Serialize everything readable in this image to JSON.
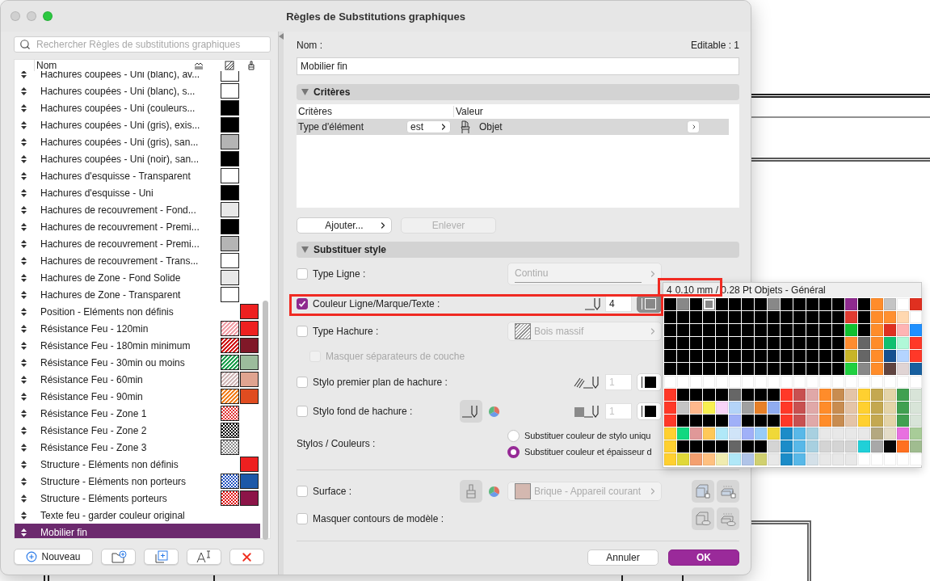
{
  "window": {
    "title": "Règles de Substitutions graphiques"
  },
  "sidebar": {
    "search": {
      "placeholder": "Rechercher Règles de substitutions graphiques"
    },
    "column": "Nom",
    "items": [
      {
        "name": "Hachures coupées - Uni (blanc), av...",
        "selected": false,
        "fill": {
          "kind": "solid",
          "color": "#ffffff"
        }
      },
      {
        "name": "Hachures coupées - Uni (blanc), s...",
        "selected": false,
        "fill": {
          "kind": "solid",
          "color": "#ffffff"
        }
      },
      {
        "name": "Hachures coupées - Uni (couleurs...",
        "selected": false,
        "fill": {
          "kind": "solid",
          "color": "#000000"
        }
      },
      {
        "name": "Hachures coupées - Uni (gris), exis...",
        "selected": false,
        "fill": {
          "kind": "solid",
          "color": "#000000"
        }
      },
      {
        "name": "Hachures coupées - Uni (gris), san...",
        "selected": false,
        "fill": {
          "kind": "solid",
          "color": "#b4b4b4"
        }
      },
      {
        "name": "Hachures coupées - Uni (noir), san...",
        "selected": false,
        "fill": {
          "kind": "solid",
          "color": "#000000"
        }
      },
      {
        "name": "Hachures d'esquisse - Transparent",
        "selected": false,
        "fill": {
          "kind": "solid",
          "color": "#ffffff"
        }
      },
      {
        "name": "Hachures d'esquisse - Uni",
        "selected": false,
        "fill": {
          "kind": "solid",
          "color": "#000000"
        }
      },
      {
        "name": "Hachures de recouvrement - Fond...",
        "selected": false,
        "fill": {
          "kind": "solid",
          "color": "#e8e8e8"
        }
      },
      {
        "name": "Hachures de recouvrement - Premi...",
        "selected": false,
        "fill": {
          "kind": "solid",
          "color": "#000000"
        }
      },
      {
        "name": "Hachures de recouvrement - Premi...",
        "selected": false,
        "fill": {
          "kind": "solid",
          "color": "#b4b4b4"
        }
      },
      {
        "name": "Hachures de recouvrement - Trans...",
        "selected": false,
        "fill": {
          "kind": "solid",
          "color": "#ffffff"
        }
      },
      {
        "name": "Hachures de Zone - Fond Solide",
        "selected": false,
        "fill": {
          "kind": "solid",
          "color": "#e8e8e8"
        }
      },
      {
        "name": "Hachures de Zone - Transparent",
        "selected": false,
        "fill": {
          "kind": "solid",
          "color": "#ffffff"
        }
      },
      {
        "name": "Position - Eléments non définis",
        "selected": false,
        "pen": {
          "color": "#ee2020"
        }
      },
      {
        "name": "Résistance Feu - 120min",
        "selected": false,
        "fill": {
          "kind": "hatch",
          "color": "#f0a0a8"
        },
        "pen": {
          "color": "#ee2020"
        }
      },
      {
        "name": "Résistance Feu - 180min minimum",
        "selected": false,
        "fill": {
          "kind": "hatch",
          "color": "#d01818"
        },
        "pen": {
          "color": "#801828"
        }
      },
      {
        "name": "Résistance Feu - 30min ou moins",
        "selected": false,
        "fill": {
          "kind": "hatch",
          "color": "#20a050"
        },
        "pen": {
          "color": "#9cbc9c"
        }
      },
      {
        "name": "Résistance Feu - 60min",
        "selected": false,
        "fill": {
          "kind": "hatch",
          "color": "#d0b8b8"
        },
        "pen": {
          "color": "#e0a490"
        }
      },
      {
        "name": "Résistance Feu - 90min",
        "selected": false,
        "fill": {
          "kind": "hatch",
          "color": "#f08020"
        },
        "pen": {
          "color": "#e04c20"
        }
      },
      {
        "name": "Résistance Feu - Zone 1",
        "selected": false,
        "fill": {
          "kind": "dots",
          "color": "#e03030"
        }
      },
      {
        "name": "Résistance Feu - Zone 2",
        "selected": false,
        "fill": {
          "kind": "dots",
          "color": "#000000"
        }
      },
      {
        "name": "Résistance Feu - Zone 3",
        "selected": false,
        "fill": {
          "kind": "dots",
          "color": "#888888"
        }
      },
      {
        "name": "Structure - Eléments non définis",
        "selected": false,
        "pen": {
          "color": "#ee2020"
        }
      },
      {
        "name": "Structure - Eléments non porteurs",
        "selected": false,
        "fill": {
          "kind": "dots",
          "color": "#2050c0"
        },
        "pen": {
          "color": "#1c58a8"
        }
      },
      {
        "name": "Structure - Eléments porteurs",
        "selected": false,
        "fill": {
          "kind": "dots",
          "color": "#e01010"
        },
        "pen": {
          "color": "#8c1448"
        }
      },
      {
        "name": "Texte feu - garder couleur original",
        "selected": false
      },
      {
        "name": "Mobilier fin",
        "selected": true
      }
    ],
    "new_button": "Nouveau"
  },
  "rule": {
    "name_label": "Nom :",
    "editable": "Editable : 1",
    "name_value": "Mobilier fin",
    "criteria": {
      "title": "Critères",
      "expanded": true,
      "columns": [
        "Critères",
        "Valeur"
      ],
      "rows": [
        {
          "criterion": "Type d'élément",
          "operator": "est",
          "value": "Objet",
          "selected": true
        }
      ],
      "buttons": [
        {
          "label": "Ajouter...",
          "disabled": false
        },
        {
          "label": "Enlever",
          "disabled": true
        }
      ]
    },
    "style": {
      "title": "Substituer style",
      "expanded": true,
      "options": [
        {
          "kind": "line_type",
          "label": "Type Ligne :",
          "checked": false,
          "value": "Continu"
        },
        {
          "kind": "pen",
          "label": "Couleur Ligne/Marque/Texte :",
          "checked": true,
          "pen": "4"
        },
        {
          "kind": "fill_type",
          "label": "Type Hachure :",
          "checked": false,
          "value": "Bois massif"
        },
        {
          "kind": "sub_check",
          "label": "Masquer séparateurs de couche",
          "checked": false,
          "disabled": true
        },
        {
          "kind": "fill_pen",
          "label": "Stylo premier plan de hachure :",
          "checked": false,
          "pen": "1"
        },
        {
          "kind": "fill_bg_pen",
          "label": "Stylo fond de hachure :",
          "checked": false,
          "pen": "1"
        },
        {
          "kind": "radio_group",
          "label": "Stylos / Couleurs :",
          "choices": [
            {
              "label": "Substituer couleur de stylo uniqu",
              "selected": false
            },
            {
              "label": "Substituer couleur et épaisseur d",
              "selected": true
            }
          ]
        },
        {
          "kind": "surface",
          "label": "Surface :",
          "checked": false,
          "value": "Brique - Appareil courant",
          "color": "#d4b8b0"
        },
        {
          "kind": "model_contours",
          "label": "Masquer contours de modèle :",
          "checked": false
        }
      ]
    },
    "buttons": [
      {
        "label": "Annuler",
        "primary": false
      },
      {
        "label": "OK",
        "primary": true
      }
    ]
  },
  "palette": {
    "pen": "4",
    "caption": "0.10 mm / 0.28 Pt Objets - Général",
    "rows": [
      [
        {
          "color": "#000000"
        },
        {
          "color": "#888888"
        },
        {
          "color": "#000000"
        },
        {
          "color": "#888888"
        },
        {
          "color": "#000000"
        },
        {
          "color": "#000000"
        },
        {
          "color": "#000000"
        },
        {
          "color": "#000000"
        },
        {
          "color": "#888888"
        },
        {
          "color": "#000000"
        },
        {
          "color": "#000000"
        },
        {
          "color": "#000000"
        },
        {
          "color": "#000000"
        },
        {
          "color": "#000000"
        },
        {
          "color": "#8e2a8e"
        },
        {
          "color": "#000000"
        },
        {
          "color": "#ff8c2a"
        },
        {
          "color": "#c4c4c4"
        },
        {
          "color": "#ffffff"
        },
        {
          "color": "#e03020"
        }
      ],
      [
        {
          "color": "#000000"
        },
        {
          "color": "#000000"
        },
        {
          "color": "#000000"
        },
        {
          "color": "#000000"
        },
        {
          "color": "#000000"
        },
        {
          "color": "#000000"
        },
        {
          "color": "#000000"
        },
        {
          "color": "#000000"
        },
        {
          "color": "#000000"
        },
        {
          "color": "#000000"
        },
        {
          "color": "#000000"
        },
        {
          "color": "#000000"
        },
        {
          "color": "#000000"
        },
        {
          "color": "#000000"
        },
        {
          "color": "#e03a30"
        },
        {
          "color": "#000000"
        },
        {
          "color": "#ff8c2a"
        },
        {
          "color": "#ff9030"
        },
        {
          "color": "#ffd8b0"
        },
        {
          "color": "#ffffff"
        }
      ],
      [
        {
          "color": "#000000"
        },
        {
          "color": "#000000"
        },
        {
          "color": "#000000"
        },
        {
          "color": "#000000"
        },
        {
          "color": "#000000"
        },
        {
          "color": "#000000"
        },
        {
          "color": "#000000"
        },
        {
          "color": "#000000"
        },
        {
          "color": "#000000"
        },
        {
          "color": "#000000"
        },
        {
          "color": "#000000"
        },
        {
          "color": "#000000"
        },
        {
          "color": "#000000"
        },
        {
          "color": "#000000"
        },
        {
          "color": "#10c030"
        },
        {
          "color": "#000000"
        },
        {
          "color": "#ff8c2a"
        },
        {
          "color": "#e03020"
        },
        {
          "color": "#ffb4b4"
        },
        {
          "color": "#2090ff"
        }
      ],
      [
        {
          "color": "#000000"
        },
        {
          "color": "#000000"
        },
        {
          "color": "#000000"
        },
        {
          "color": "#000000"
        },
        {
          "color": "#000000"
        },
        {
          "color": "#000000"
        },
        {
          "color": "#000000"
        },
        {
          "color": "#000000"
        },
        {
          "color": "#000000"
        },
        {
          "color": "#000000"
        },
        {
          "color": "#000000"
        },
        {
          "color": "#000000"
        },
        {
          "color": "#000000"
        },
        {
          "color": "#000000"
        },
        {
          "color": "#ff8c30"
        },
        {
          "color": "#666666"
        },
        {
          "color": "#ff8c2a"
        },
        {
          "color": "#10c070"
        },
        {
          "color": "#b0f8d8"
        },
        {
          "color": "#ff3828"
        }
      ],
      [
        {
          "color": "#000000"
        },
        {
          "color": "#000000"
        },
        {
          "color": "#000000"
        },
        {
          "color": "#000000"
        },
        {
          "color": "#000000"
        },
        {
          "color": "#000000"
        },
        {
          "color": "#000000"
        },
        {
          "color": "#000000"
        },
        {
          "color": "#000000"
        },
        {
          "color": "#000000"
        },
        {
          "color": "#000000"
        },
        {
          "color": "#000000"
        },
        {
          "color": "#000000"
        },
        {
          "color": "#000000"
        },
        {
          "color": "#c8b428"
        },
        {
          "color": "#666666"
        },
        {
          "color": "#ff8c2a"
        },
        {
          "color": "#155090"
        },
        {
          "color": "#b4d4ff"
        },
        {
          "color": "#ff3828"
        }
      ],
      [
        {
          "color": "#000000"
        },
        {
          "color": "#000000"
        },
        {
          "color": "#000000"
        },
        {
          "color": "#000000"
        },
        {
          "color": "#000000"
        },
        {
          "color": "#000000"
        },
        {
          "color": "#000000"
        },
        {
          "color": "#000000"
        },
        {
          "color": "#000000"
        },
        {
          "color": "#000000"
        },
        {
          "color": "#000000"
        },
        {
          "color": "#000000"
        },
        {
          "color": "#000000"
        },
        {
          "color": "#000000"
        },
        {
          "color": "#20d040"
        },
        {
          "color": "#888888"
        },
        {
          "color": "#ff8c2a"
        },
        {
          "color": "#604440"
        },
        {
          "color": "#e0d4d4"
        },
        {
          "color": "#1860a0"
        }
      ],
      [
        {
          "color": "#ffffff"
        },
        {
          "color": "#ffffff"
        },
        {
          "color": "#ffffff"
        },
        {
          "color": "#ffffff"
        },
        {
          "color": "#ffffff"
        },
        {
          "color": "#ffffff"
        },
        {
          "color": "#ffffff"
        },
        {
          "color": "#ffffff"
        },
        {
          "color": "#ffffff"
        },
        {
          "color": "#ffffff"
        },
        {
          "color": "#ffffff"
        },
        {
          "color": "#ffffff"
        },
        {
          "color": "#ffffff"
        },
        {
          "color": "#ffffff"
        },
        {
          "color": "#ffffff"
        },
        {
          "color": "#ffffff"
        },
        {
          "color": "#ffffff"
        },
        {
          "color": "#ffffff"
        },
        {
          "color": "#ffffff"
        },
        {
          "color": "#ffffff"
        }
      ],
      [
        {
          "color": "#ff3828"
        },
        {
          "color": "#000000"
        },
        {
          "color": "#000000"
        },
        {
          "color": "#000000"
        },
        {
          "color": "#000000"
        },
        {
          "color": "#666666"
        },
        {
          "color": "#000000"
        },
        {
          "color": "#000000"
        },
        {
          "color": "#000000"
        },
        {
          "color": "#ff3828"
        },
        {
          "color": "#c85050"
        },
        {
          "color": "#e0a8a8"
        },
        {
          "color": "#ff8c2a"
        },
        {
          "color": "#c88c50"
        },
        {
          "color": "#e4c4a8"
        },
        {
          "color": "#ffd030"
        },
        {
          "color": "#c4a850"
        },
        {
          "color": "#e4d4a8"
        },
        {
          "color": "#40a050"
        },
        {
          "color": "#d8e4d8"
        }
      ],
      [
        {
          "color": "#ff3828"
        },
        {
          "color": "#c4c4c4"
        },
        {
          "color": "#ffb88c"
        },
        {
          "color": "#f8f050"
        },
        {
          "color": "#f8d4f8"
        },
        {
          "color": "#b4d4f8"
        },
        {
          "color": "#a0a0a0"
        },
        {
          "color": "#e88028"
        },
        {
          "color": "#90acf0"
        },
        {
          "color": "#ff3828"
        },
        {
          "color": "#c85050"
        },
        {
          "color": "#e0a8a8"
        },
        {
          "color": "#ff8c2a"
        },
        {
          "color": "#c88c50"
        },
        {
          "color": "#e4c4a8"
        },
        {
          "color": "#ffd030"
        },
        {
          "color": "#c4a850"
        },
        {
          "color": "#e4d4a8"
        },
        {
          "color": "#40a050"
        },
        {
          "color": "#d8e4d8"
        }
      ],
      [
        {
          "color": "#ff3828"
        },
        {
          "color": "#000000"
        },
        {
          "color": "#000000"
        },
        {
          "color": "#000000"
        },
        {
          "color": "#000000"
        },
        {
          "color": "#a0b0f8"
        },
        {
          "color": "#000000"
        },
        {
          "color": "#000000"
        },
        {
          "color": "#000000"
        },
        {
          "color": "#ff3828"
        },
        {
          "color": "#c85050"
        },
        {
          "color": "#e0a8a8"
        },
        {
          "color": "#ff8c2a"
        },
        {
          "color": "#c88c50"
        },
        {
          "color": "#e4c4a8"
        },
        {
          "color": "#ffd030"
        },
        {
          "color": "#c4a850"
        },
        {
          "color": "#e4d4a8"
        },
        {
          "color": "#40a050"
        },
        {
          "color": "#d8e4d8"
        }
      ],
      [
        {
          "color": "#ffd030"
        },
        {
          "color": "#10d880"
        },
        {
          "color": "#e09898"
        },
        {
          "color": "#ffc858"
        },
        {
          "color": "#b0e8f8"
        },
        {
          "color": "#d0e4f8"
        },
        {
          "color": "#a0b0f8"
        },
        {
          "color": "#98ccf8"
        },
        {
          "color": "#f0d838"
        },
        {
          "color": "#1c8cc8"
        },
        {
          "color": "#58b8e8"
        },
        {
          "color": "#a8d0e0"
        },
        {
          "color": "#e8e8e8"
        },
        {
          "color": "#e8e8e8"
        },
        {
          "color": "#e8e8e8"
        },
        {
          "color": "#e8e8e8"
        },
        {
          "color": "#b4a880"
        },
        {
          "color": "#e4dcc8"
        },
        {
          "color": "#e870e0"
        },
        {
          "color": "#a8cc98"
        }
      ],
      [
        {
          "color": "#ffd030"
        },
        {
          "color": "#000000"
        },
        {
          "color": "#000000"
        },
        {
          "color": "#000000"
        },
        {
          "color": "#000000"
        },
        {
          "color": "#666666"
        },
        {
          "color": "#000000"
        },
        {
          "color": "#000000"
        },
        {
          "color": "#d4d4d4"
        },
        {
          "color": "#1c8cc8"
        },
        {
          "color": "#58b8e8"
        },
        {
          "color": "#a8d0e0"
        },
        {
          "color": "#d4d4d4"
        },
        {
          "color": "#d4d4d4"
        },
        {
          "color": "#d4d4d4"
        },
        {
          "color": "#20d0d8"
        },
        {
          "color": "#a8a8a8"
        },
        {
          "color": "#080808"
        },
        {
          "color": "#ff7020"
        },
        {
          "color": "#a0bc90"
        }
      ],
      [
        {
          "color": "#ffd030"
        },
        {
          "color": "#e0d838"
        },
        {
          "color": "#f4a070"
        },
        {
          "color": "#ffc080"
        },
        {
          "color": "#f0ecb0"
        },
        {
          "color": "#b0e8f8"
        },
        {
          "color": "#b0c4e8"
        },
        {
          "color": "#d0d070"
        },
        {
          "color": "#e8e8e8"
        },
        {
          "color": "#1c8cc8"
        },
        {
          "color": "#58b8e8"
        },
        {
          "color": "#d4e0e8"
        },
        {
          "color": "#e8e8e8"
        },
        {
          "color": "#e8e8e8"
        },
        {
          "color": "#e8e8e8"
        },
        {
          "color": "#ffffff"
        },
        {
          "color": "#ffffff"
        },
        {
          "color": "#ffffff"
        },
        {
          "color": "#ffffff"
        },
        {
          "color": "#ffffff"
        }
      ]
    ]
  }
}
